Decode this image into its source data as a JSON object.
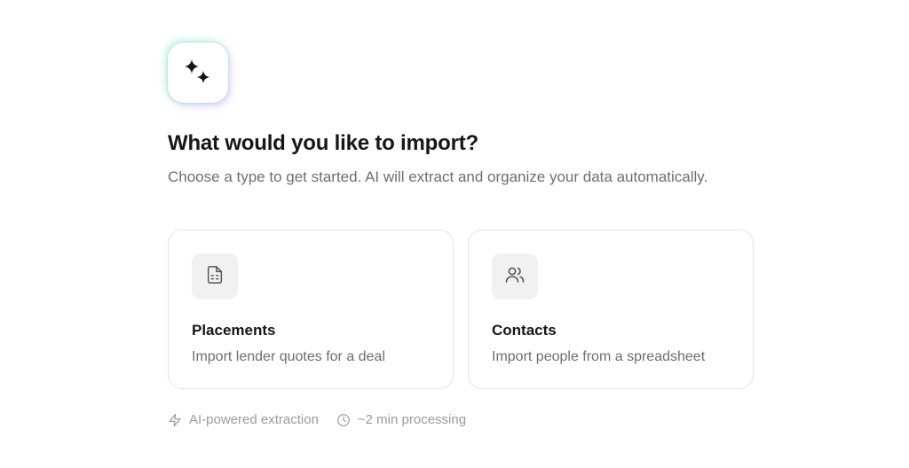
{
  "logo": {
    "icon": "sparkles-icon"
  },
  "header": {
    "title": "What would you like to import?",
    "subtitle": "Choose a type to get started. AI will extract and organize your data automatically."
  },
  "cards": [
    {
      "icon": "spreadsheet-file-icon",
      "title": "Placements",
      "description": "Import lender quotes for a deal"
    },
    {
      "icon": "users-icon",
      "title": "Contacts",
      "description": "Import people from a spreadsheet"
    }
  ],
  "footer": {
    "items": [
      {
        "icon": "lightning-icon",
        "label": "AI-powered extraction"
      },
      {
        "icon": "clock-icon",
        "label": "~2 min processing"
      }
    ]
  },
  "colors": {
    "text_primary": "#161616",
    "text_secondary": "#6e6e6e",
    "text_muted": "#9a9a9a",
    "card_border": "#e3e3e3",
    "icon_tile": "#f1f1f1"
  }
}
